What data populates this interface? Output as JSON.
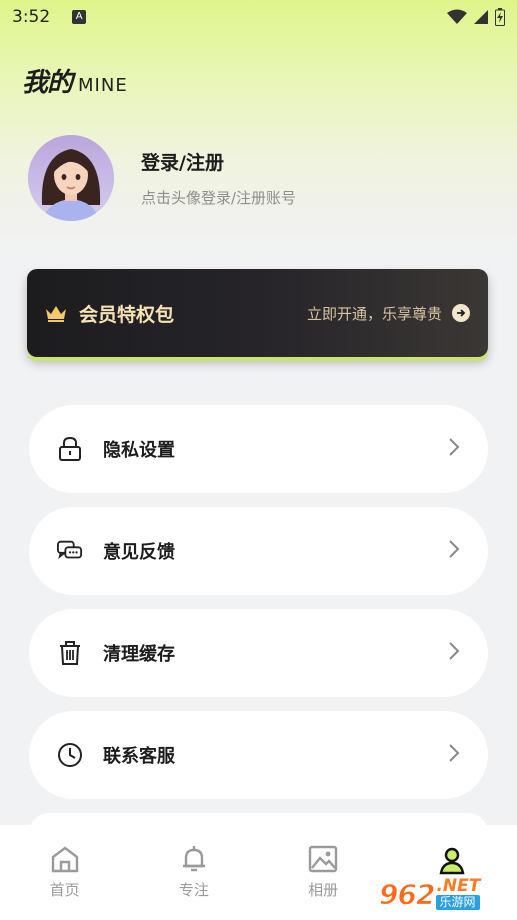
{
  "status_bar": {
    "time": "3:52",
    "app_icon_letter": "A"
  },
  "header": {
    "title": "我的",
    "subtitle": "MINE"
  },
  "profile": {
    "title": "登录/注册",
    "subtitle": "点击头像登录/注册账号"
  },
  "vip": {
    "title": "会员特权包",
    "action": "立即开通，乐享尊贵"
  },
  "menu": [
    {
      "label": "隐私设置",
      "icon": "lock-icon"
    },
    {
      "label": "意见反馈",
      "icon": "chat-icon"
    },
    {
      "label": "清理缓存",
      "icon": "trash-icon"
    },
    {
      "label": "联系客服",
      "icon": "clock-icon"
    }
  ],
  "tabs": [
    {
      "label": "首页",
      "icon": "home-icon"
    },
    {
      "label": "专注",
      "icon": "bell-icon"
    },
    {
      "label": "相册",
      "icon": "image-icon"
    },
    {
      "label": "",
      "icon": "user-icon"
    }
  ],
  "watermark": {
    "number": "962",
    "suffix": ".NET",
    "cn": "乐游网"
  },
  "colors": {
    "accent": "#d9f27a",
    "vip_text": "#f7e3b6",
    "vip_bg": "#1c1c1e",
    "tab_active": "#111111",
    "tab_inactive": "#9a9a9a"
  }
}
